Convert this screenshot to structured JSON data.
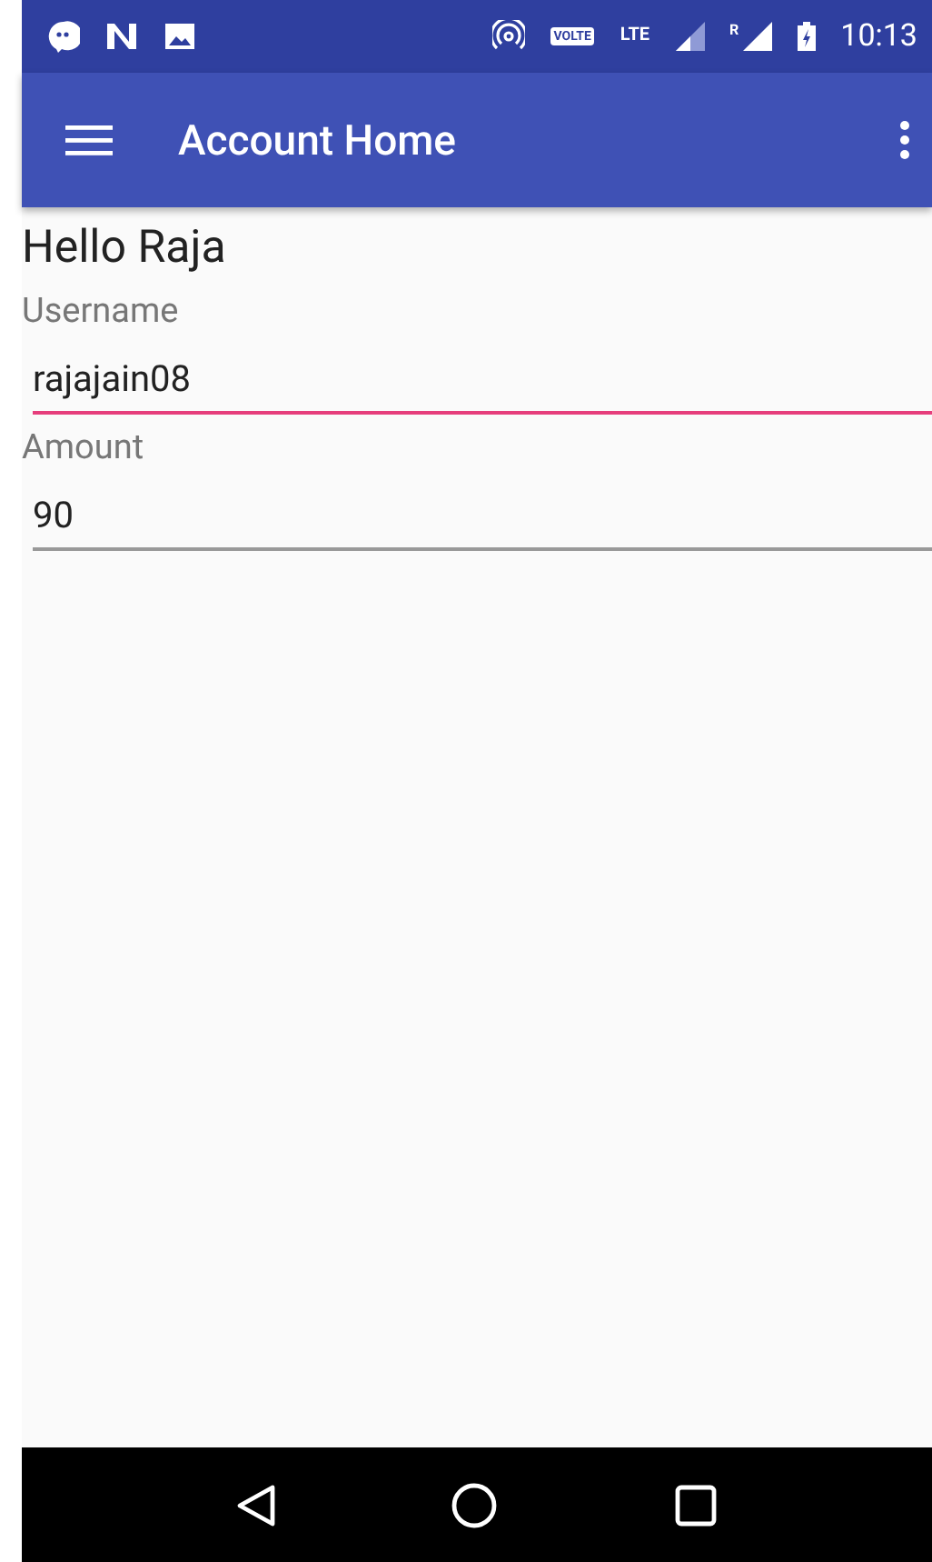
{
  "status_bar": {
    "volte": "VOLTE",
    "network": "LTE",
    "roaming": "R",
    "time": "10:13"
  },
  "app_bar": {
    "title": "Account Home"
  },
  "greeting": "Hello Raja",
  "fields": [
    {
      "label": "Username",
      "value": "rajajain08",
      "focused": true
    },
    {
      "label": "Amount",
      "value": "90",
      "focused": false
    }
  ]
}
